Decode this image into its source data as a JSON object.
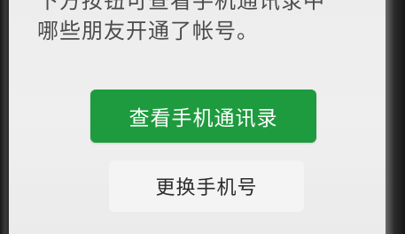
{
  "screen": {
    "description_lines": [
      "下方按钮可查看手机通讯录中",
      "哪些朋友开通了帐号。"
    ],
    "primary_button": "查看手机通讯录",
    "secondary_button": "更换手机号"
  },
  "colors": {
    "primary_green": "#1e9b3e",
    "background": "#ededed",
    "secondary_bg": "#f4f4f4"
  }
}
